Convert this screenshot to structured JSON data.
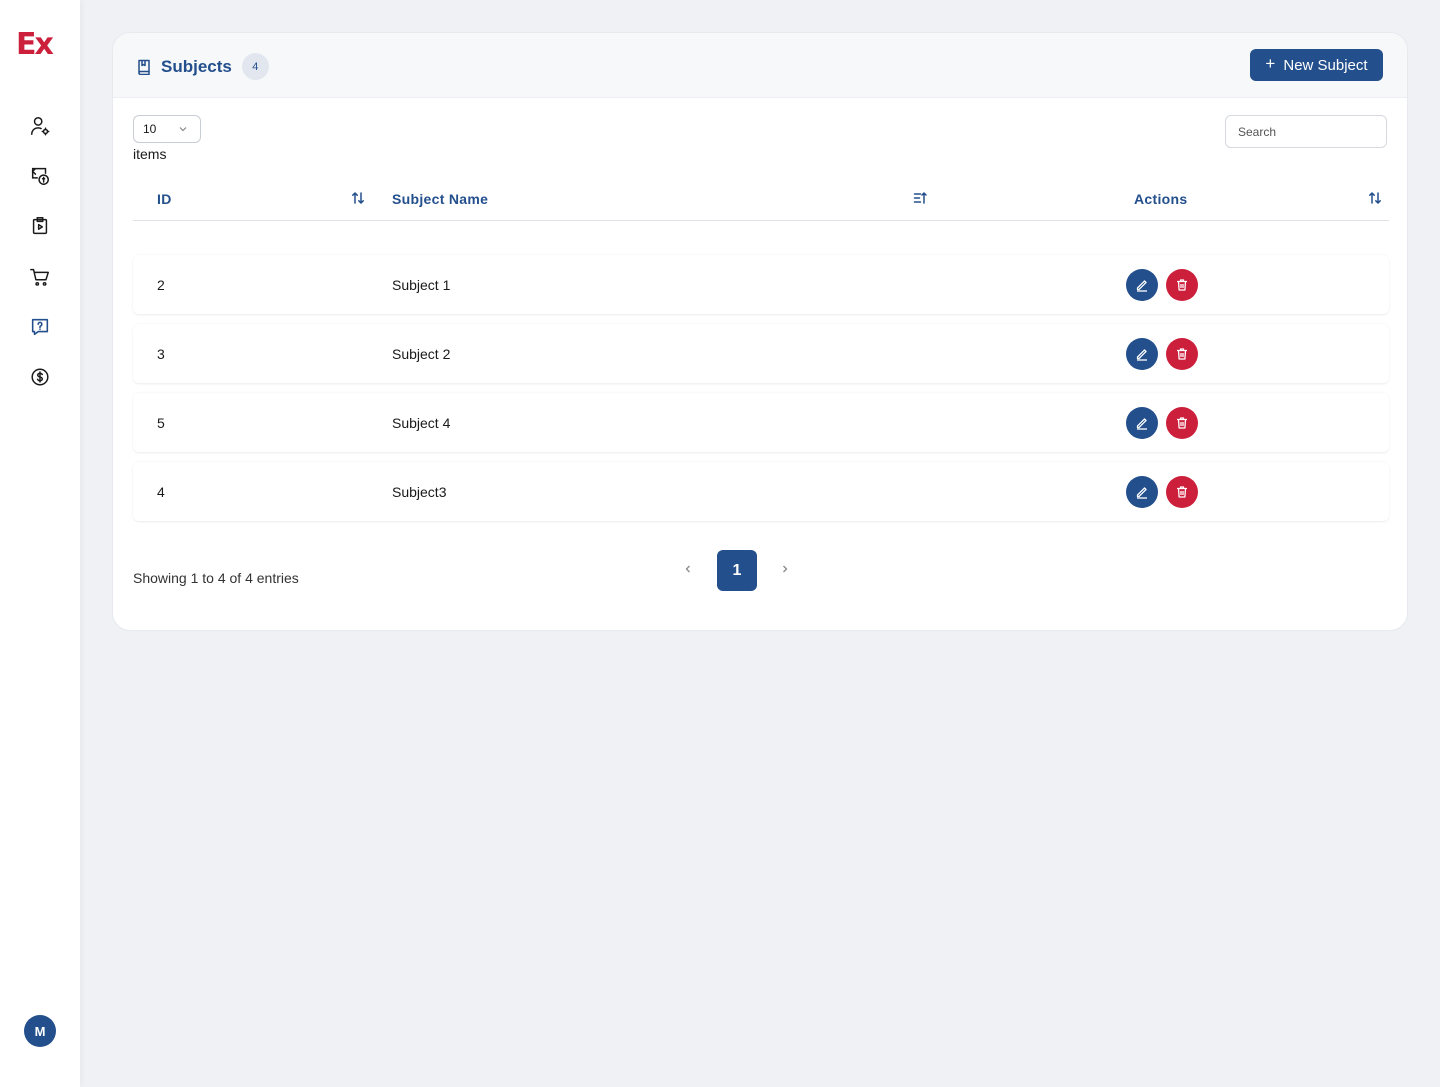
{
  "brand": {
    "logo_text": "Ex",
    "primary_color": "#234f8c",
    "accent_color": "#cc1f3c"
  },
  "sidebar": {
    "items": [
      {
        "icon": "user-gear-icon"
      },
      {
        "icon": "money-transfer-icon"
      },
      {
        "icon": "clipboard-play-icon"
      },
      {
        "icon": "cart-icon"
      },
      {
        "icon": "question-chat-icon",
        "active": true
      },
      {
        "icon": "dollar-circle-icon"
      }
    ],
    "avatar_initial": "M"
  },
  "header": {
    "title": "Subjects",
    "count": "4",
    "new_button_label": "New Subject"
  },
  "controls": {
    "page_size": "10",
    "items_label": "items",
    "search_placeholder": "Search"
  },
  "table": {
    "columns": [
      "ID",
      "Subject Name",
      "Actions"
    ],
    "rows": [
      {
        "id": "2",
        "name": "Subject 1"
      },
      {
        "id": "3",
        "name": "Subject 2"
      },
      {
        "id": "5",
        "name": "Subject 4"
      },
      {
        "id": "4",
        "name": "Subject3"
      }
    ]
  },
  "footer": {
    "showing_text": "Showing 1 to 4 of 4 entries",
    "current_page": "1"
  }
}
